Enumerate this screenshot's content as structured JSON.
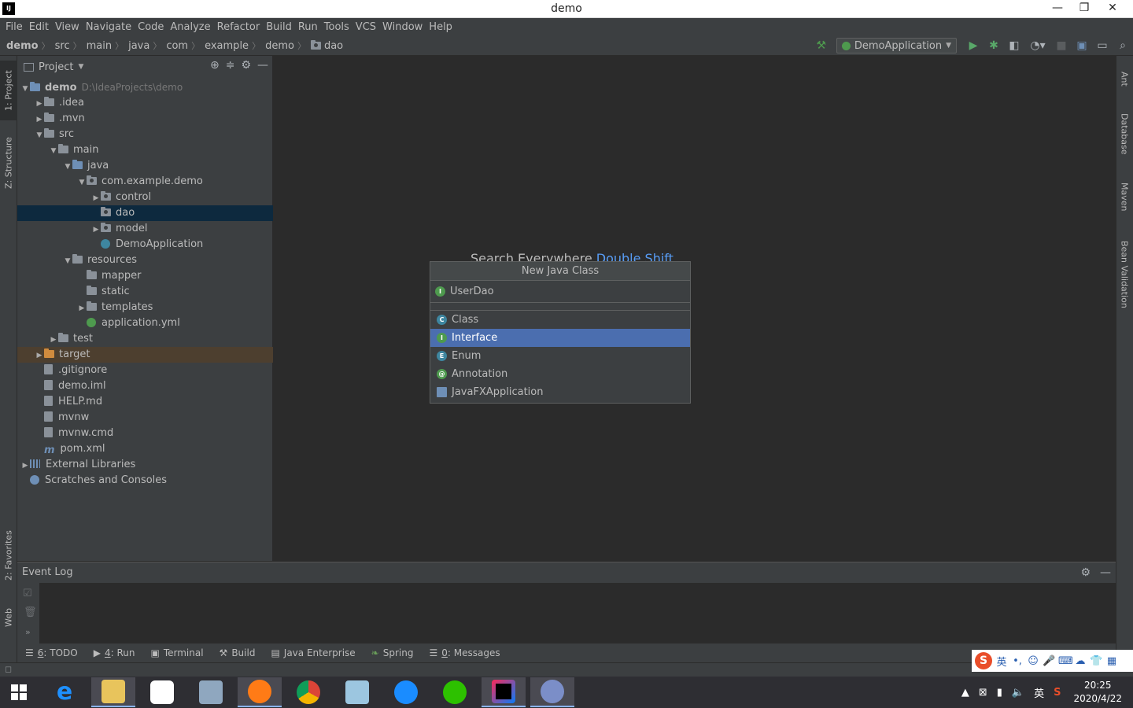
{
  "window": {
    "title": "demo",
    "minimize": "—",
    "restore": "❐",
    "close": "✕"
  },
  "menu": [
    "File",
    "Edit",
    "View",
    "Navigate",
    "Code",
    "Analyze",
    "Refactor",
    "Build",
    "Run",
    "Tools",
    "VCS",
    "Window",
    "Help"
  ],
  "breadcrumbs": [
    "demo",
    "src",
    "main",
    "java",
    "com",
    "example",
    "demo",
    "dao"
  ],
  "toolbar": {
    "run_config": "DemoApplication"
  },
  "left_tabs": {
    "project": "1: Project",
    "structure": "Z: Structure",
    "favorites": "2: Favorites",
    "web": "Web"
  },
  "right_tabs": {
    "ant": "Ant",
    "database": "Database",
    "maven": "Maven",
    "bean_validation": "Bean Validation"
  },
  "project_panel": {
    "title": "Project",
    "tree": [
      {
        "label": "demo",
        "path": "D:\\IdeaProjects\\demo",
        "depth": 0,
        "arrow": "▼",
        "icon": "module-folder"
      },
      {
        "label": ".idea",
        "depth": 1,
        "arrow": "▶",
        "icon": "folder"
      },
      {
        "label": ".mvn",
        "depth": 1,
        "arrow": "▶",
        "icon": "folder"
      },
      {
        "label": "src",
        "depth": 1,
        "arrow": "▼",
        "icon": "folder"
      },
      {
        "label": "main",
        "depth": 2,
        "arrow": "▼",
        "icon": "folder"
      },
      {
        "label": "java",
        "depth": 3,
        "arrow": "▼",
        "icon": "source-folder"
      },
      {
        "label": "com.example.demo",
        "depth": 4,
        "arrow": "▼",
        "icon": "package"
      },
      {
        "label": "control",
        "depth": 5,
        "arrow": "▶",
        "icon": "package"
      },
      {
        "label": "dao",
        "depth": 5,
        "arrow": "",
        "icon": "package",
        "selected": true
      },
      {
        "label": "model",
        "depth": 5,
        "arrow": "▶",
        "icon": "package"
      },
      {
        "label": "DemoApplication",
        "depth": 5,
        "arrow": "",
        "icon": "spring-class"
      },
      {
        "label": "resources",
        "depth": 3,
        "arrow": "▼",
        "icon": "resources-folder"
      },
      {
        "label": "mapper",
        "depth": 4,
        "arrow": "",
        "icon": "folder"
      },
      {
        "label": "static",
        "depth": 4,
        "arrow": "",
        "icon": "folder"
      },
      {
        "label": "templates",
        "depth": 4,
        "arrow": "▶",
        "icon": "folder"
      },
      {
        "label": "application.yml",
        "depth": 4,
        "arrow": "",
        "icon": "spring-config"
      },
      {
        "label": "test",
        "depth": 2,
        "arrow": "▶",
        "icon": "folder"
      },
      {
        "label": "target",
        "depth": 1,
        "arrow": "▶",
        "icon": "excluded-folder",
        "excluded": true
      },
      {
        "label": ".gitignore",
        "depth": 1,
        "arrow": "",
        "icon": "file"
      },
      {
        "label": "demo.iml",
        "depth": 1,
        "arrow": "",
        "icon": "file"
      },
      {
        "label": "HELP.md",
        "depth": 1,
        "arrow": "",
        "icon": "file"
      },
      {
        "label": "mvnw",
        "depth": 1,
        "arrow": "",
        "icon": "file"
      },
      {
        "label": "mvnw.cmd",
        "depth": 1,
        "arrow": "",
        "icon": "file"
      },
      {
        "label": "pom.xml",
        "depth": 1,
        "arrow": "",
        "icon": "maven-file"
      },
      {
        "label": "External Libraries",
        "depth": 0,
        "arrow": "▶",
        "icon": "libraries"
      },
      {
        "label": "Scratches and Consoles",
        "depth": 0,
        "arrow": "",
        "icon": "scratches"
      }
    ]
  },
  "editor": {
    "hint_label": "Search Everywhere",
    "hint_shortcut": "Double Shift"
  },
  "new_class_popup": {
    "title": "New Java Class",
    "name_value": "UserDao",
    "items": [
      {
        "label": "Class",
        "letter": "C",
        "color": "#3e86a0",
        "selected": false
      },
      {
        "label": "Interface",
        "letter": "I",
        "color": "#4e9a4e",
        "selected": true
      },
      {
        "label": "Enum",
        "letter": "E",
        "color": "#3e86a0",
        "selected": false
      },
      {
        "label": "Annotation",
        "letter": "@",
        "color": "#4e9a4e",
        "selected": false
      },
      {
        "label": "JavaFXApplication",
        "letter": "",
        "color": "#6e8fb6",
        "selected": false
      }
    ]
  },
  "event_log": {
    "title": "Event Log"
  },
  "bottom_tabs": [
    {
      "num": "6",
      "label": ": TODO"
    },
    {
      "num": "4",
      "label": ": Run"
    },
    {
      "num": "",
      "label": "Terminal"
    },
    {
      "num": "",
      "label": "Build"
    },
    {
      "num": "",
      "label": "Java Enterprise"
    },
    {
      "num": "",
      "label": "Spring"
    },
    {
      "num": "0",
      "label": ": Messages"
    }
  ],
  "ime": {
    "lang": "英"
  },
  "taskbar": {
    "time": "20:25",
    "date": "2020/4/22",
    "tray_lang": "英"
  },
  "colors": {
    "accent": "#4b6eaf",
    "selection": "#0d293e",
    "excluded": "#4d3f2f",
    "link": "#589df6"
  }
}
